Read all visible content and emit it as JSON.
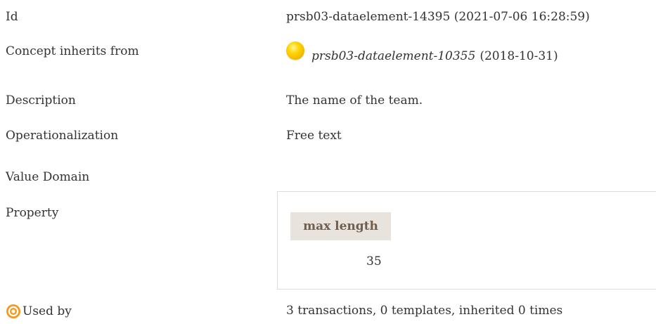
{
  "rows": {
    "id": {
      "label": "Id",
      "value": "prsb03-dataelement-14395 (2021-07-06 16:28:59)"
    },
    "inherits": {
      "label": "Concept inherits from",
      "link_text": "prsb03-dataelement-10355",
      "date": "(2018-10-31)",
      "status_icon": "yellow-circle-status",
      "status_color": "#ffd400"
    },
    "description": {
      "label": "Description",
      "value": "The name of the team."
    },
    "operationalization": {
      "label": "Operationalization",
      "value": "Free text"
    },
    "value_domain": {
      "label": "Value Domain"
    },
    "property": {
      "label": "Property",
      "header": "max length",
      "value": "35"
    },
    "used_by": {
      "label": "Used by",
      "icon": "target-icon",
      "icon_color": "#f29a1f",
      "value": "3 transactions, 0 templates, inherited 0 times"
    }
  }
}
